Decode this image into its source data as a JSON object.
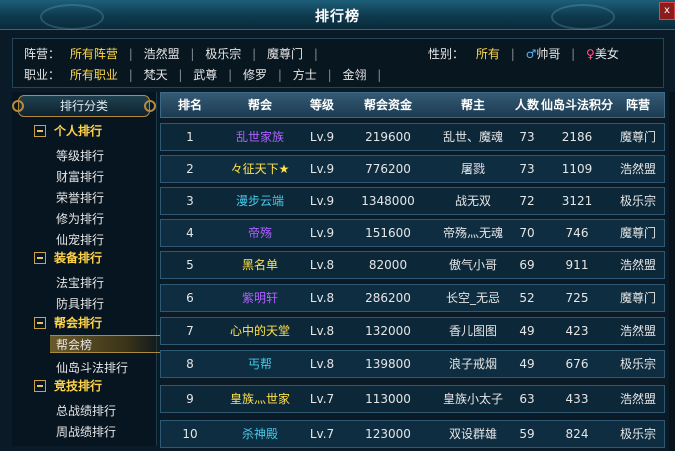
{
  "window": {
    "title": "排行榜",
    "close_label": "x"
  },
  "filters": {
    "camp": {
      "label": "阵营：",
      "options": [
        "所有阵营",
        "浩然盟",
        "极乐宗",
        "魔尊门"
      ],
      "selected": "所有阵营"
    },
    "profession": {
      "label": "职业：",
      "options": [
        "所有职业",
        "梵天",
        "武尊",
        "修罗",
        "方士",
        "金翎"
      ],
      "selected": "所有职业"
    },
    "gender": {
      "label": "性别：",
      "options": [
        "所有",
        "帅哥",
        "美女"
      ],
      "selected": "所有",
      "male_symbol": "♂",
      "female_symbol": "♀"
    },
    "separator": "|"
  },
  "sidebar": {
    "header": "排行分类",
    "categories": [
      {
        "label": "个人排行",
        "items": [
          "等级排行",
          "财富排行",
          "荣誉排行",
          "修为排行",
          "仙宠排行"
        ]
      },
      {
        "label": "装备排行",
        "items": [
          "法宝排行",
          "防具排行"
        ]
      },
      {
        "label": "帮会排行",
        "items": [
          "帮会榜",
          "仙岛斗法排行"
        ]
      },
      {
        "label": "竞技排行",
        "items": [
          "总战绩排行",
          "周战绩排行"
        ]
      }
    ],
    "active_item": "帮会榜"
  },
  "table": {
    "columns": [
      "排名",
      "帮会",
      "等级",
      "帮会资金",
      "帮主",
      "人数",
      "仙岛斗法积分",
      "阵营"
    ],
    "rows": [
      {
        "rank": "1",
        "guild": "乱世家族",
        "guild_color": "#b060ff",
        "level": "Lv.9",
        "funds": "219600",
        "leader": "乱世、魔魂",
        "members": "73",
        "score": "2186",
        "camp": "魔尊门"
      },
      {
        "rank": "2",
        "guild": "々征天下★",
        "guild_color": "#ffe24a",
        "level": "Lv.9",
        "funds": "776200",
        "leader": "屠戮",
        "members": "73",
        "score": "1109",
        "camp": "浩然盟"
      },
      {
        "rank": "3",
        "guild": "漫步云端",
        "guild_color": "#46c8e8",
        "level": "Lv.9",
        "funds": "1348000",
        "leader": "战无双",
        "members": "72",
        "score": "3121",
        "camp": "极乐宗"
      },
      {
        "rank": "4",
        "guild": "帝殇",
        "guild_color": "#b060ff",
        "level": "Lv.9",
        "funds": "151600",
        "leader": "帝殇灬无魂",
        "members": "70",
        "score": "746",
        "camp": "魔尊门"
      },
      {
        "rank": "5",
        "guild": "黑名单",
        "guild_color": "#ffe24a",
        "level": "Lv.8",
        "funds": "82000",
        "leader": "傲气小哥",
        "members": "69",
        "score": "911",
        "camp": "浩然盟"
      },
      {
        "rank": "6",
        "guild": "紫明轩",
        "guild_color": "#b060ff",
        "level": "Lv.8",
        "funds": "286200",
        "leader": "长空_无忌",
        "members": "52",
        "score": "725",
        "camp": "魔尊门"
      },
      {
        "rank": "7",
        "guild": "心中的天堂",
        "guild_color": "#ffe24a",
        "level": "Lv.8",
        "funds": "132000",
        "leader": "香儿图图",
        "members": "49",
        "score": "423",
        "camp": "浩然盟"
      },
      {
        "rank": "8",
        "guild": "丐帮",
        "guild_color": "#46c8e8",
        "level": "Lv.8",
        "funds": "139800",
        "leader": "浪子戒烟",
        "members": "49",
        "score": "676",
        "camp": "极乐宗"
      },
      {
        "rank": "9",
        "guild": "皇族灬世家",
        "guild_color": "#ffe24a",
        "level": "Lv.7",
        "funds": "113000",
        "leader": "皇族小太子",
        "members": "63",
        "score": "433",
        "camp": "浩然盟"
      },
      {
        "rank": "10",
        "guild": "杀神殿",
        "guild_color": "#46c8e8",
        "level": "Lv.7",
        "funds": "123000",
        "leader": "双设群雄",
        "members": "59",
        "score": "824",
        "camp": "极乐宗"
      }
    ]
  }
}
